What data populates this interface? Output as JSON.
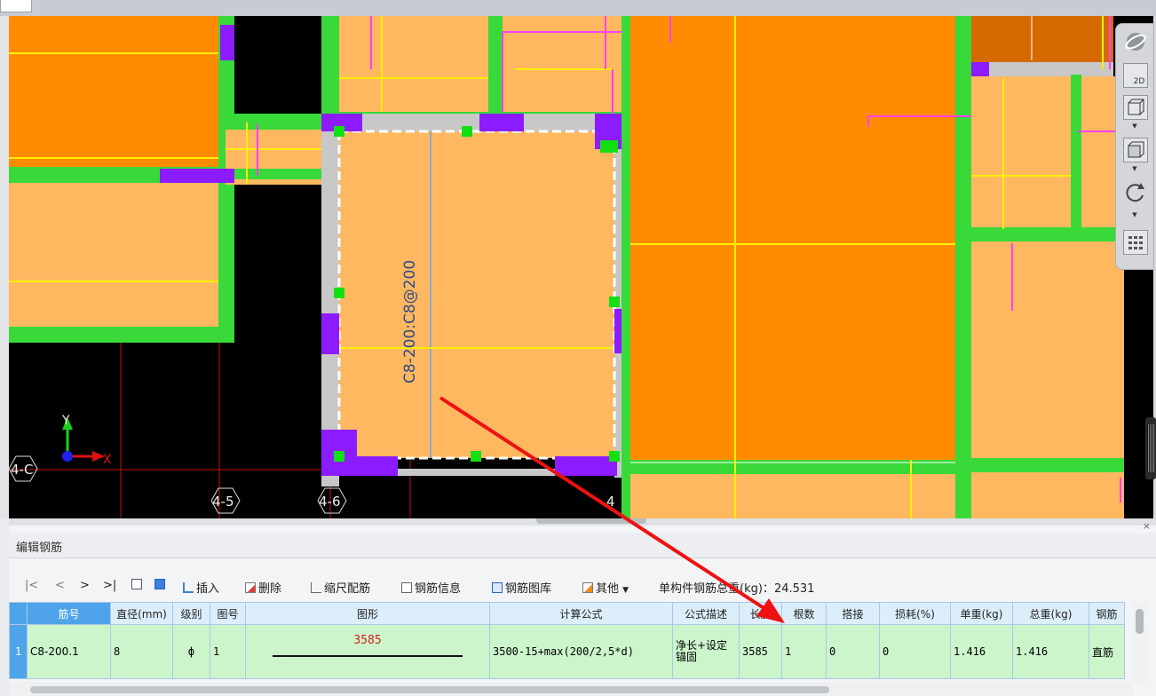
{
  "viewport": {
    "rebar_label": "C8-200:C8@200",
    "axis_x": "X",
    "axis_y": "Y",
    "grid_row": "4-C",
    "grid_col_1": "4-5",
    "grid_col_2": "4-6",
    "grid_col_3": "4"
  },
  "view_toolbar": {
    "mode_2d": "2D"
  },
  "panel": {
    "title": "编辑钢筋",
    "close": "×"
  },
  "toolbar": {
    "nav_first": "|<",
    "nav_prev": "<",
    "nav_next": ">",
    "nav_last": ">|",
    "insert": "插入",
    "delete": "删除",
    "scale_rebar": "缩尺配筋",
    "rebar_info": "钢筋信息",
    "rebar_library": "钢筋图库",
    "other": "其他",
    "weight_label": "单构件钢筋总重(kg)：",
    "weight_value": "24.531"
  },
  "table": {
    "headers": [
      "筋号",
      "直径(mm)",
      "级别",
      "图号",
      "图形",
      "计算公式",
      "公式描述",
      "长度",
      "根数",
      "搭接",
      "损耗(%)",
      "单重(kg)",
      "总重(kg)",
      "钢筋"
    ],
    "rows": [
      {
        "index": "1",
        "bar_no": "C8-200.1",
        "diameter": "8",
        "grade": "ф",
        "shape_no": "1",
        "shape_length": "3585",
        "formula": "3500-15+max(200/2,5*d)",
        "description": "净长+设定锚固",
        "length": "3585",
        "count": "1",
        "lap": "0",
        "loss": "0",
        "unit_weight": "1.416",
        "total_weight": "1.416",
        "rebar_type": "直筋"
      }
    ]
  },
  "colors": {
    "slab_orange": "#ff8c00",
    "slab_light": "#ffb860",
    "beam_green": "#39d93a",
    "column_purple": "#8c1cff",
    "rebar_yellow": "#ffef00",
    "rebar_magenta": "#ff40ff",
    "axis_red": "#e01010",
    "annotation_arrow": "#ee1111"
  }
}
